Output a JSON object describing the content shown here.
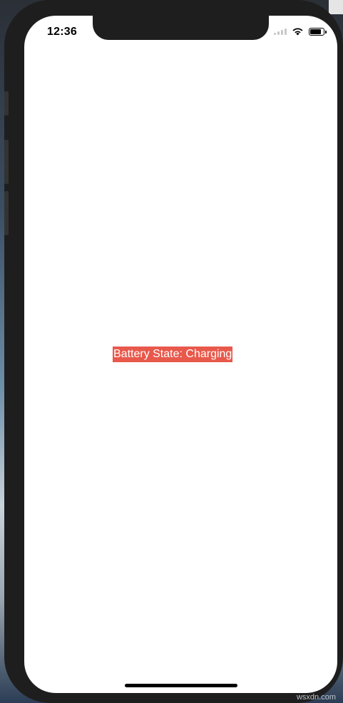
{
  "status_bar": {
    "time": "12:36",
    "icons": [
      "cellular-signal-icon",
      "wifi-icon",
      "battery-icon"
    ]
  },
  "content": {
    "battery_label": "Battery State: Charging",
    "label_background": "#e8594b",
    "label_text_color": "#ffffff"
  },
  "watermark": "wsxdn.com"
}
